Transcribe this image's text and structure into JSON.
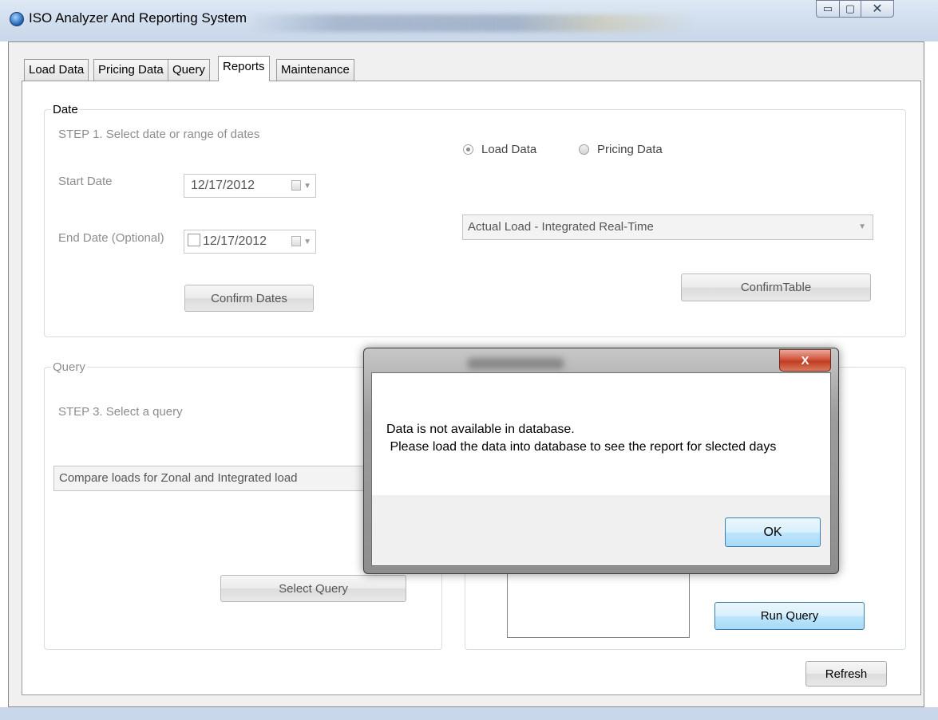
{
  "window": {
    "title": "ISO Analyzer And Reporting System",
    "minimize_glyph": "▭",
    "maximize_glyph": "▢",
    "close_glyph": "✕"
  },
  "tabs": [
    "Load Data",
    "Pricing Data",
    "Query",
    "Reports",
    "Maintenance"
  ],
  "active_tab": "Reports",
  "date_group": {
    "legend": "Date",
    "step_label": "STEP 1. Select date or range of dates",
    "start_label": "Start Date",
    "start_value": "12/17/2012",
    "end_label": "End Date (Optional)",
    "end_value": "12/17/2012",
    "confirm_dates": "Confirm Dates",
    "radio_load": "Load Data",
    "radio_pricing": "Pricing Data",
    "table_combo": "Actual Load - Integrated Real-Time",
    "confirm_table": "ConfirmTable"
  },
  "query_group": {
    "legend": "Query",
    "step_label": "STEP 3. Select a query",
    "query_combo": "Compare loads for Zonal and Integrated load",
    "select_query": "Select Query"
  },
  "run_query": "Run Query",
  "refresh": "Refresh",
  "dialog": {
    "close_label": "X",
    "line1": "Data is not available in database.",
    "line2": " Please load the data into database to see the report for slected days",
    "ok": "OK"
  },
  "colors": {
    "title_bar": "#d2dfee",
    "disabled_text": "#8d8d8d",
    "dialog_close": "#c03d22",
    "ok_highlight": "#3c7fb1"
  },
  "icons": {
    "app": "app-globe-icon",
    "calendar": "calendar-icon",
    "dropdown": "chevron-down-icon"
  }
}
